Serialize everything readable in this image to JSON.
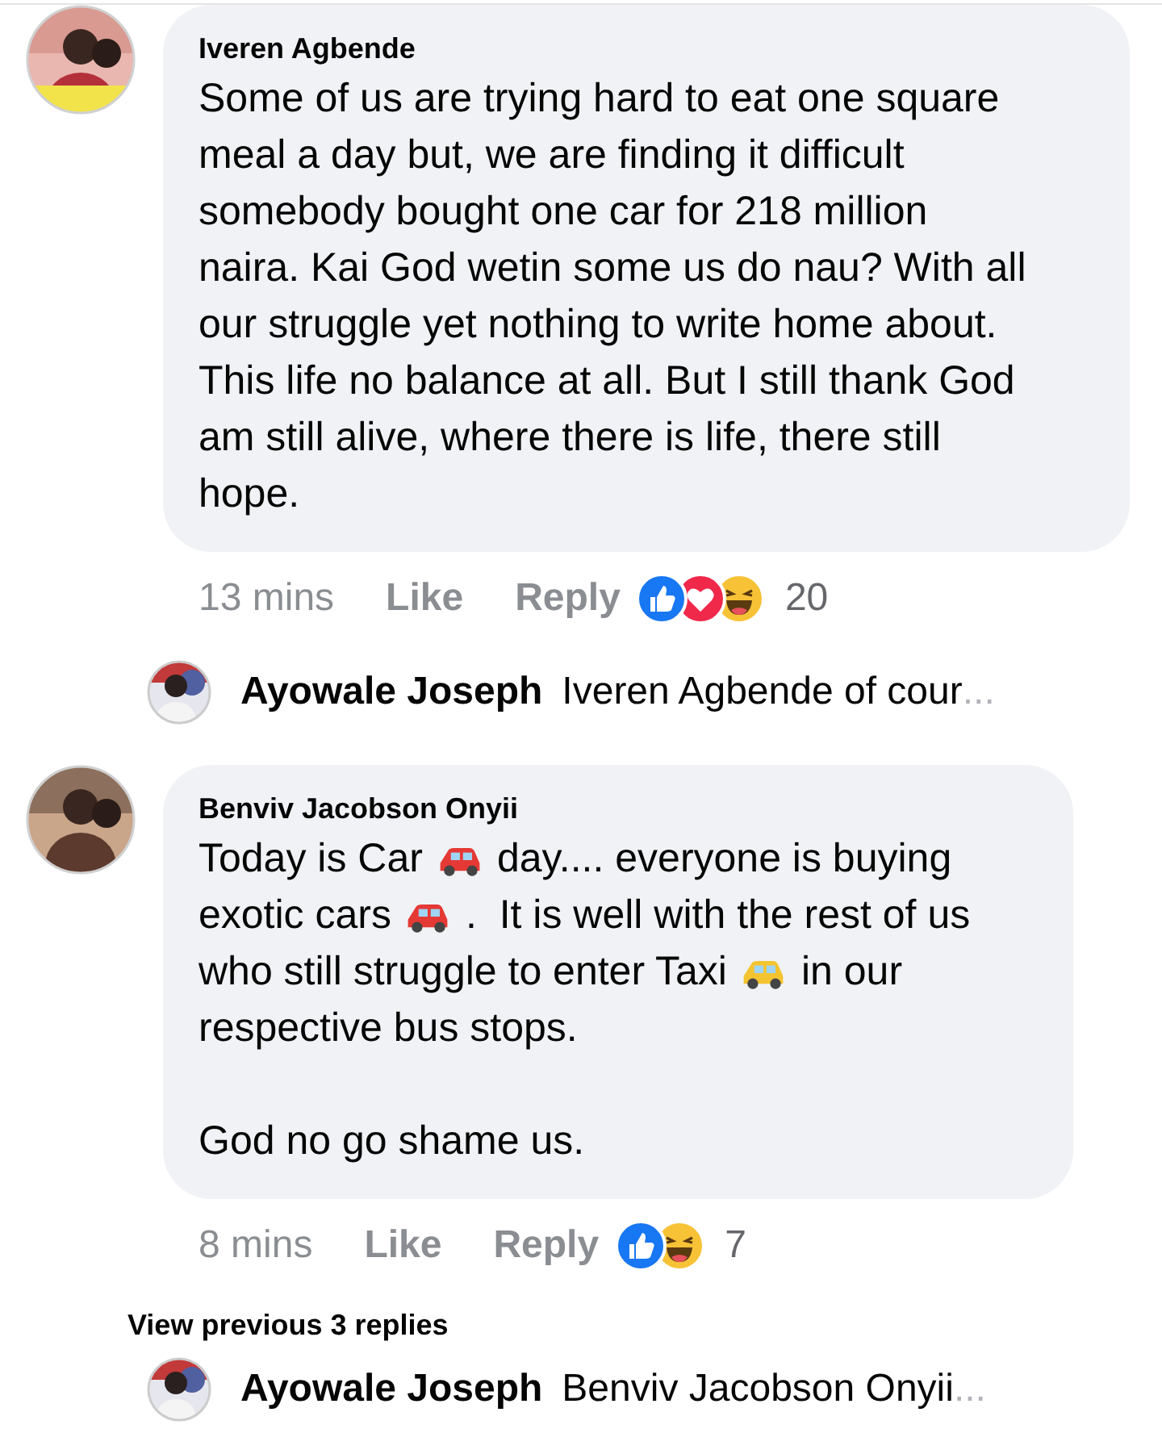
{
  "comments": [
    {
      "author": "Iveren Agbende",
      "avatar": {
        "kind": "picture"
      },
      "body": [
        [
          [
            {
              "kind": "text",
              "text": "Some of us are trying hard to eat one square"
            }
          ],
          [
            {
              "kind": "text",
              "text": "meal a day but, we are finding it difficult"
            }
          ],
          [
            {
              "kind": "text",
              "text": "somebody bought one car for 218 million"
            }
          ],
          [
            {
              "kind": "text",
              "text": "naira. Kai God wetin some us do nau? With all"
            }
          ],
          [
            {
              "kind": "text",
              "text": "our struggle yet nothing to write home about."
            }
          ],
          [
            {
              "kind": "text",
              "text": "This life no balance at all. But I still thank God"
            }
          ],
          [
            {
              "kind": "text",
              "text": "am still alive, where there is life, there still"
            }
          ],
          [
            {
              "kind": "text",
              "text": "hope."
            }
          ]
        ]
      ],
      "time": "13 mins",
      "like": "Like",
      "reply": "Reply",
      "reactions": [
        {
          "kind": "like"
        },
        {
          "kind": "love"
        },
        {
          "kind": "haha"
        }
      ],
      "reaction_count": "20",
      "reply_preview": {
        "author": "Ayowale Joseph",
        "text": "Iveren Agbende of cour",
        "ellipsis": "..."
      }
    },
    {
      "author": "Benviv Jacobson Onyii",
      "avatar": {
        "kind": "picture"
      },
      "body": [
        [
          [
            {
              "kind": "text",
              "text": "Today is Car"
            },
            {
              "kind": "emoji",
              "color": "#e53935"
            },
            {
              "kind": "text",
              "text": "day.... everyone is buying"
            }
          ],
          [
            {
              "kind": "text",
              "text": "exotic cars"
            },
            {
              "kind": "emoji",
              "color": "#e53935"
            },
            {
              "kind": "text",
              "text": ".  It is well with the rest of us"
            }
          ],
          [
            {
              "kind": "text",
              "text": "who still struggle to enter Taxi"
            },
            {
              "kind": "emoji",
              "color": "#f4c430"
            },
            {
              "kind": "text",
              "text": "in our"
            }
          ],
          [
            {
              "kind": "text",
              "text": "respective bus stops."
            }
          ]
        ],
        [
          [
            {
              "kind": "text",
              "text": "God no go shame us."
            }
          ]
        ]
      ],
      "time": "8 mins",
      "like": "Like",
      "reply": "Reply",
      "reactions": [
        {
          "kind": "like"
        },
        {
          "kind": "haha"
        }
      ],
      "reaction_count": "7",
      "view_previous": "View previous 3 replies",
      "reply_preview": {
        "author": "Ayowale Joseph",
        "text": "Benviv Jacobson Onyii",
        "ellipsis": "..."
      }
    }
  ]
}
